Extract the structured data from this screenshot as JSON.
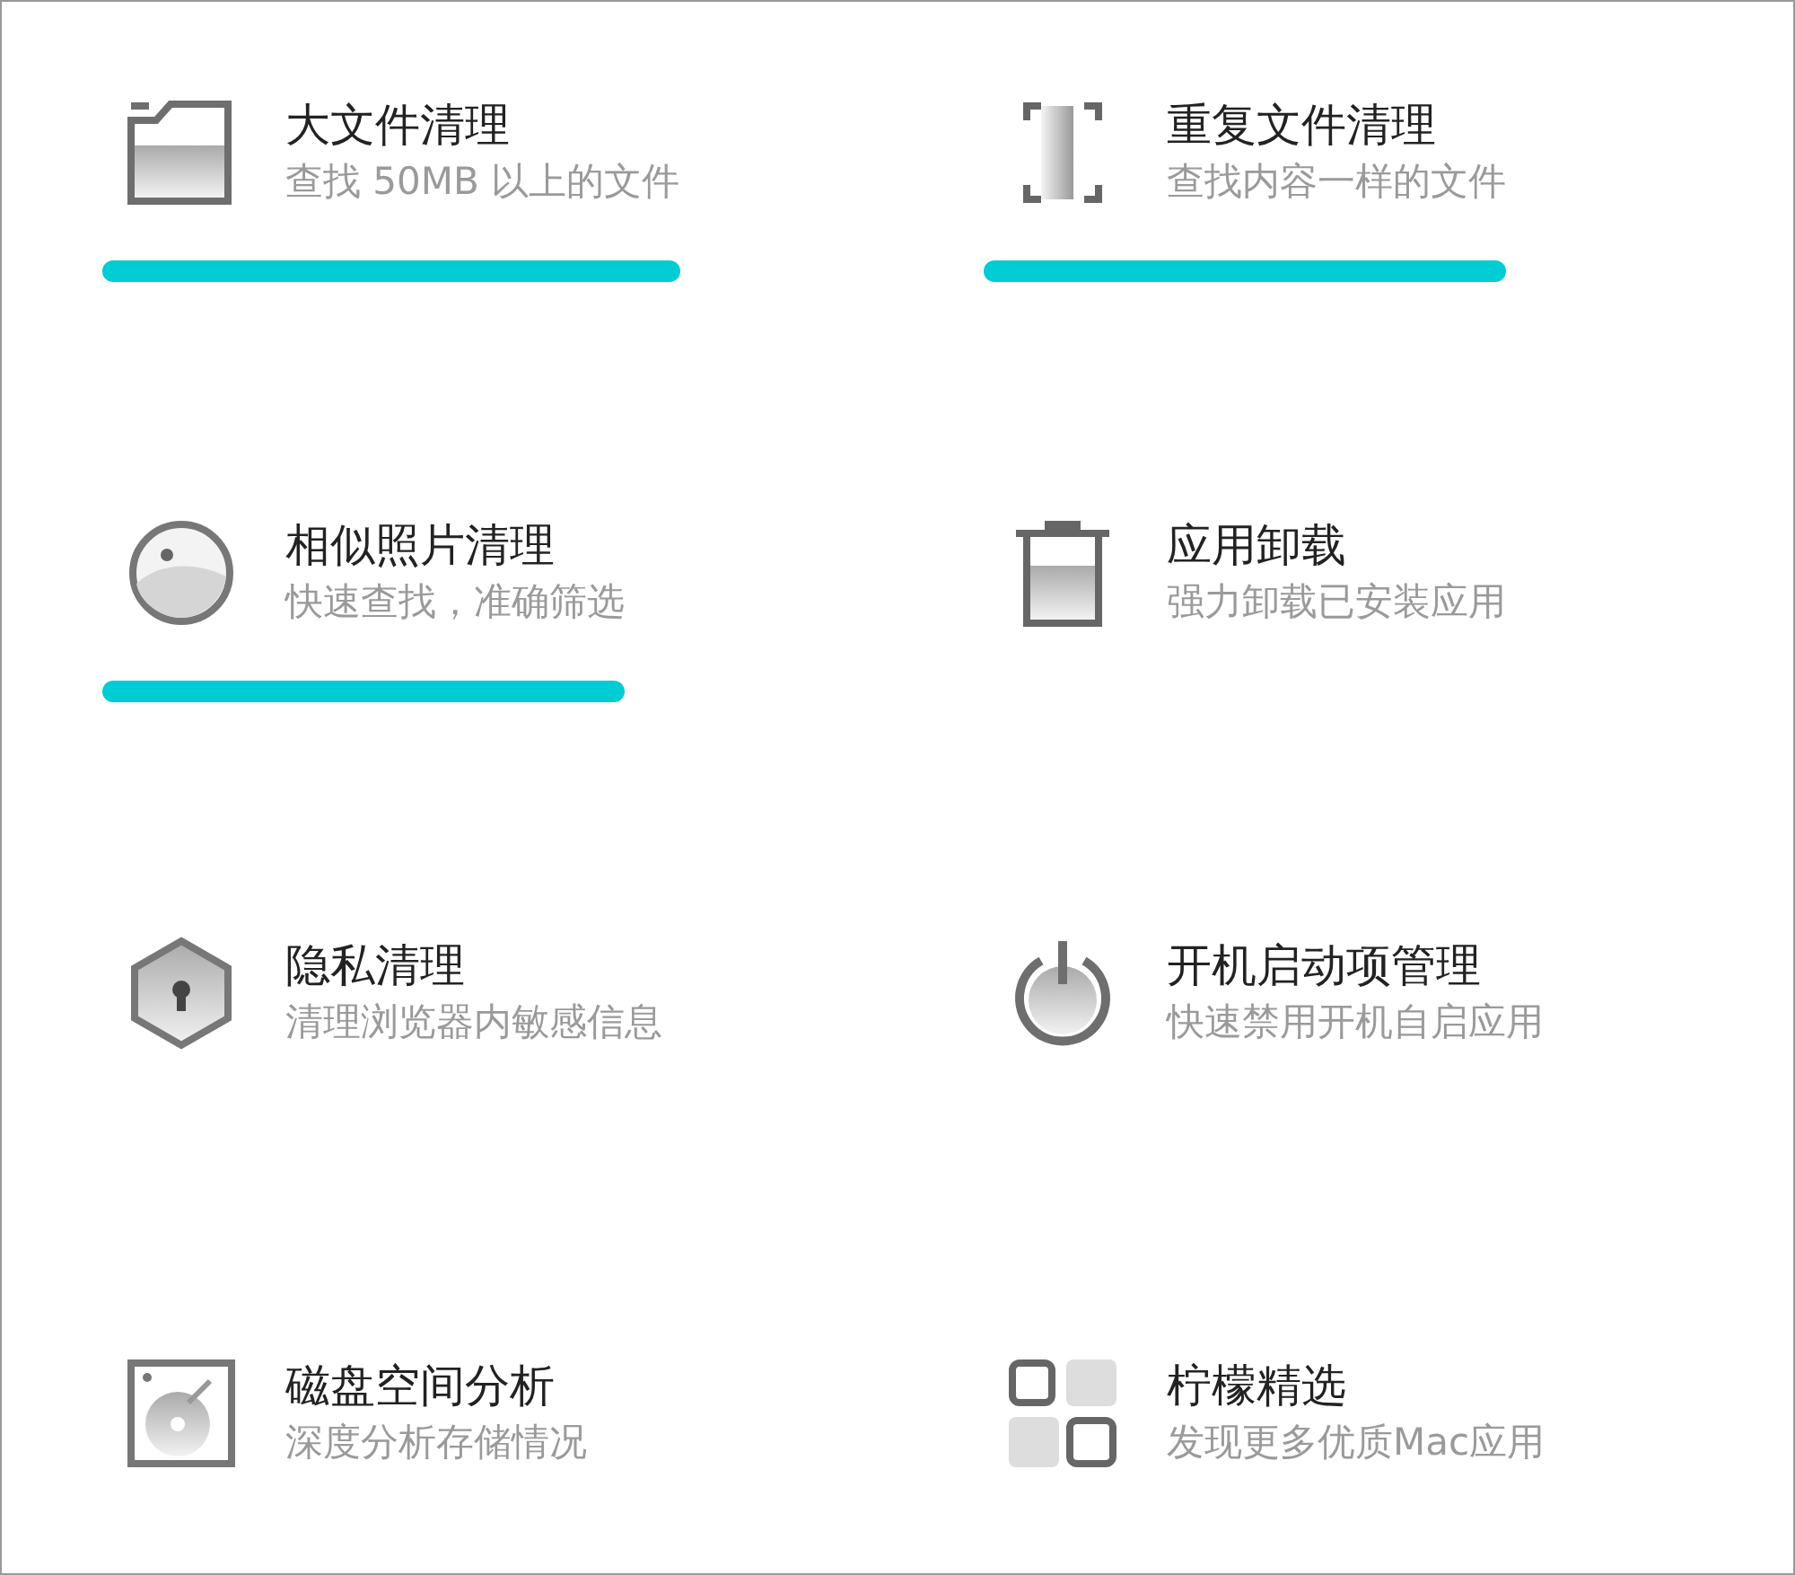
{
  "tools": [
    {
      "title": "大文件清理",
      "subtitle": "查找 50MB 以上的文件",
      "underlined": true
    },
    {
      "title": "重复文件清理",
      "subtitle": "查找内容一样的文件",
      "underlined": true
    },
    {
      "title": "相似照片清理",
      "subtitle": "快速查找，准确筛选",
      "underlined": true
    },
    {
      "title": "应用卸载",
      "subtitle": "强力卸载已安装应用",
      "underlined": false
    },
    {
      "title": "隐私清理",
      "subtitle": "清理浏览器内敏感信息",
      "underlined": false
    },
    {
      "title": "开机启动项管理",
      "subtitle": "快速禁用开机自启应用",
      "underlined": false
    },
    {
      "title": "磁盘空间分析",
      "subtitle": "深度分析存储情况",
      "underlined": false
    },
    {
      "title": "柠檬精选",
      "subtitle": "发现更多优质Mac应用",
      "underlined": false
    }
  ]
}
